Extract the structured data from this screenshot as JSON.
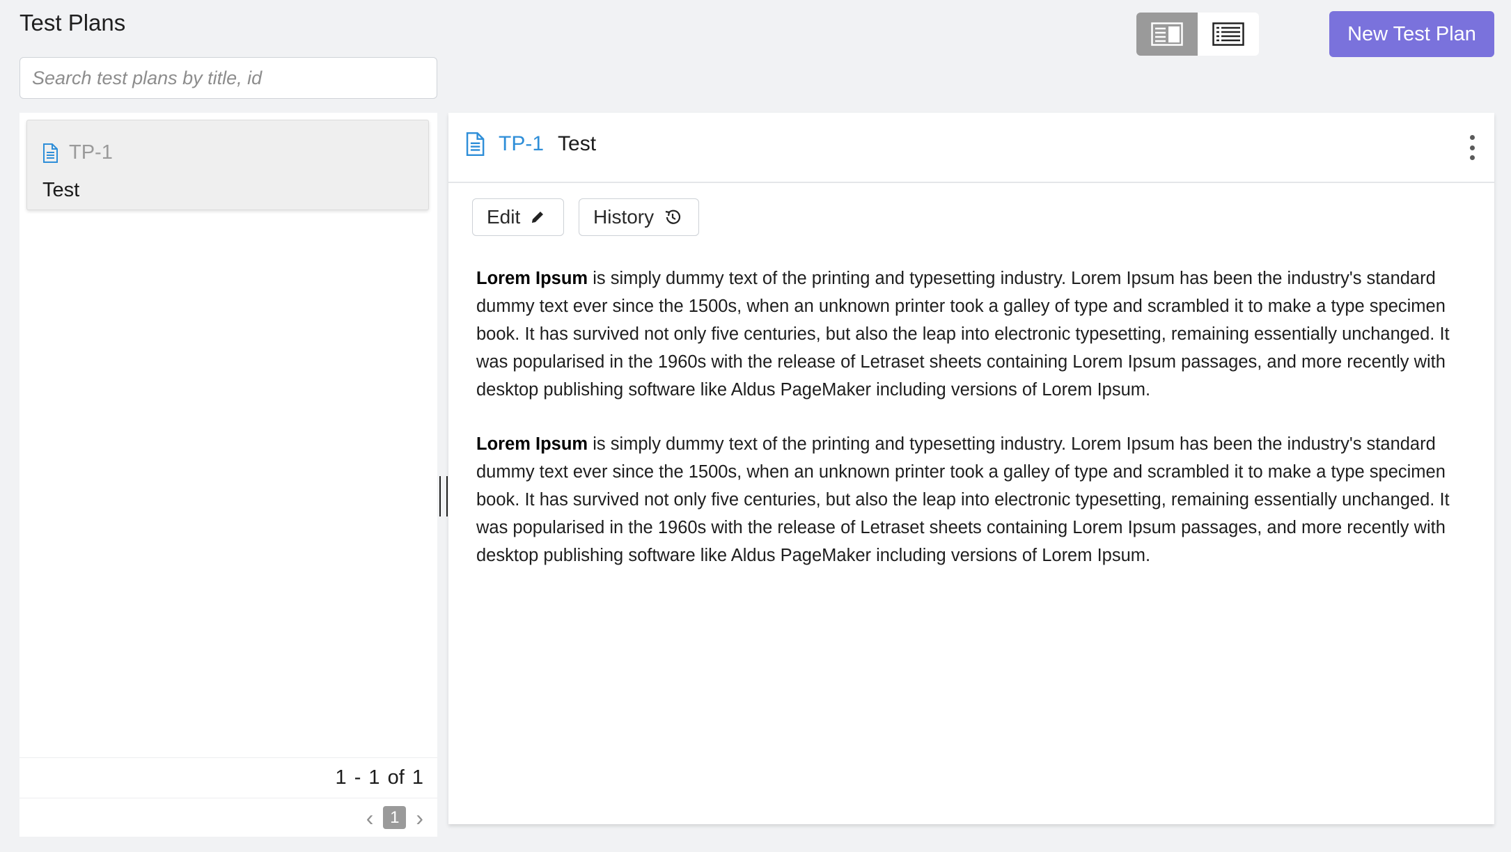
{
  "header": {
    "title": "Test Plans",
    "new_button_label": "New Test Plan",
    "view_toggle": {
      "active": "split-view",
      "options": [
        "split-view",
        "list-view"
      ]
    }
  },
  "search": {
    "placeholder": "Search test plans by title, id",
    "value": ""
  },
  "list": {
    "items": [
      {
        "id": "TP-1",
        "title": "Test"
      }
    ],
    "pagination": {
      "range": "1 - 1",
      "of_label": "of",
      "total": "1",
      "current_page": "1"
    }
  },
  "detail": {
    "id": "TP-1",
    "title": "Test",
    "edit_label": "Edit",
    "history_label": "History",
    "paragraphs": [
      {
        "bold": "Lorem Ipsum",
        "text": " is simply dummy text of the printing and typesetting industry. Lorem Ipsum has been the industry's standard dummy text ever since the 1500s, when an unknown printer took a galley of type and scrambled it to make a type specimen book. It has survived not only five centuries, but also the leap into electronic typesetting, remaining essentially unchanged. It was popularised in the 1960s with the release of Letraset sheets containing Lorem Ipsum passages, and more recently with desktop publishing software like Aldus PageMaker including versions of Lorem Ipsum."
      },
      {
        "bold": "Lorem Ipsum",
        "text": " is simply dummy text of the printing and typesetting industry. Lorem Ipsum has been the industry's standard dummy text ever since the 1500s, when an unknown printer took a galley of type and scrambled it to make a type specimen book. It has survived not only five centuries, but also the leap into electronic typesetting, remaining essentially unchanged. It was popularised in the 1960s with the release of Letraset sheets containing Lorem Ipsum passages, and more recently with desktop publishing software like Aldus PageMaker including versions of Lorem Ipsum."
      }
    ]
  },
  "colors": {
    "accent": "#7a72dc",
    "link": "#2e8ed8",
    "background": "#f1f2f4",
    "toggle_active": "#9a9a9a"
  },
  "icons": {
    "doc": "document-icon",
    "edit": "pencil-icon",
    "history": "history-icon",
    "more": "more-vertical-icon"
  }
}
